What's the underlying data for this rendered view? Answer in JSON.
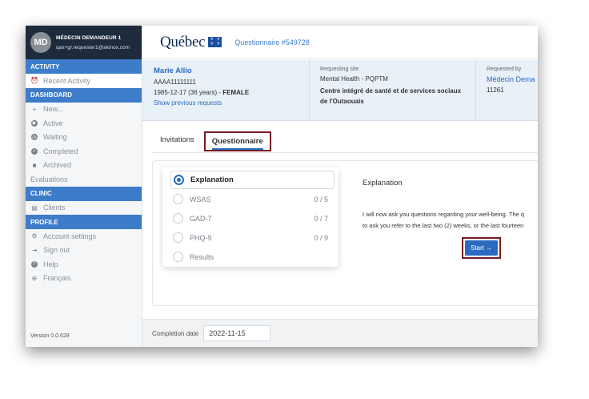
{
  "user": {
    "initials": "MD",
    "name": "MÉDECIN DEMANDEUR 1",
    "email": "qax+gr.requester1@akinox.com"
  },
  "sidebar": {
    "activity_header": "ACTIVITY",
    "recent_activity": "Recent Activity",
    "dashboard_header": "DASHBOARD",
    "new": "New...",
    "active": "Active",
    "waiting": "Waiting",
    "completed": "Completed",
    "archived": "Archived",
    "evaluations": "Evaluations",
    "clinic_header": "CLINIC",
    "clients": "Clients",
    "profile_header": "PROFILE",
    "account_settings": "Account settings",
    "sign_out": "Sign out",
    "help": "Help",
    "language": "Français",
    "version": "Version 0.0.628"
  },
  "header": {
    "logo": "Québec",
    "questionnaire_link": "Questionnaire  #549728"
  },
  "patient": {
    "name": "Marie Allio",
    "id": "AAAA11111111",
    "dob_age": "1985-12-17 (36 years) - ",
    "sex": "FEMALE",
    "previous_link": "Show previous requests",
    "requesting_site_label": "Requesting site",
    "requesting_site": "Mental Health - PQPTM",
    "requesting_org": "Centre intégré de santé et de services sociaux de l'Outaouais",
    "requested_by_label": "Requested by",
    "requested_by": "Médecin Dema",
    "requested_by_id": "11261"
  },
  "tabs": {
    "invitations": "Invitations",
    "questionnaire": "Questionnaire"
  },
  "questionnaire_items": [
    {
      "label": "Explanation",
      "score": ""
    },
    {
      "label": "WSAS",
      "score": "0 / 5"
    },
    {
      "label": "GAD-7",
      "score": "0 / 7"
    },
    {
      "label": "PHQ-9",
      "score": "0 / 9"
    },
    {
      "label": "Results",
      "score": ""
    }
  ],
  "explanation": {
    "title": "Explanation",
    "line1": "I will now ask you questions regarding your well-being. The q",
    "line2": "to ask you refer to the last two (2) weeks, or the last fourteen",
    "start_label": "Start →"
  },
  "footer": {
    "completion_label": "Completion date",
    "completion_date": "2022-11-15"
  },
  "colors": {
    "accent": "#3d7cc9",
    "highlight_border": "#7a1b25",
    "sidebar_dark": "#1e2b3c"
  }
}
